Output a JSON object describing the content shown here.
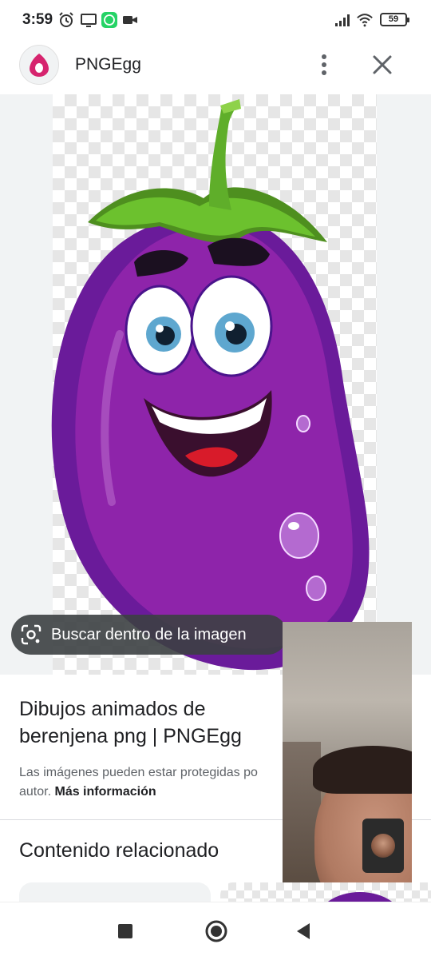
{
  "status_bar": {
    "time": "3:59",
    "icons": [
      "alarm-icon",
      "screen-icon",
      "whatsapp-icon",
      "video-camera-icon",
      "signal-icon",
      "wifi-icon"
    ],
    "battery": "59"
  },
  "header": {
    "site_name": "PNGEgg",
    "logo_icon": "pngegg-logo-icon",
    "more_icon": "more-vert-icon",
    "close_icon": "close-icon"
  },
  "image": {
    "lens_chip_label": "Buscar dentro de la imagen",
    "lens_icon": "lens-icon"
  },
  "result": {
    "title": "Dibujos animados de berenjena png | PNGEgg",
    "disclaimer": "Las imágenes pueden estar protegidas po",
    "disclaimer_line2": "autor.",
    "more_info_link": "Más información"
  },
  "related": {
    "heading": "Contenido relacionado"
  },
  "nav_bar": {
    "buttons": [
      "recents-icon",
      "home-icon",
      "back-icon"
    ]
  },
  "colors": {
    "eggplant_purple": "#7b1fa2",
    "stem_green": "#5fae2a",
    "chip_background": "#3c4043",
    "logo_pink": "#d6246e"
  }
}
